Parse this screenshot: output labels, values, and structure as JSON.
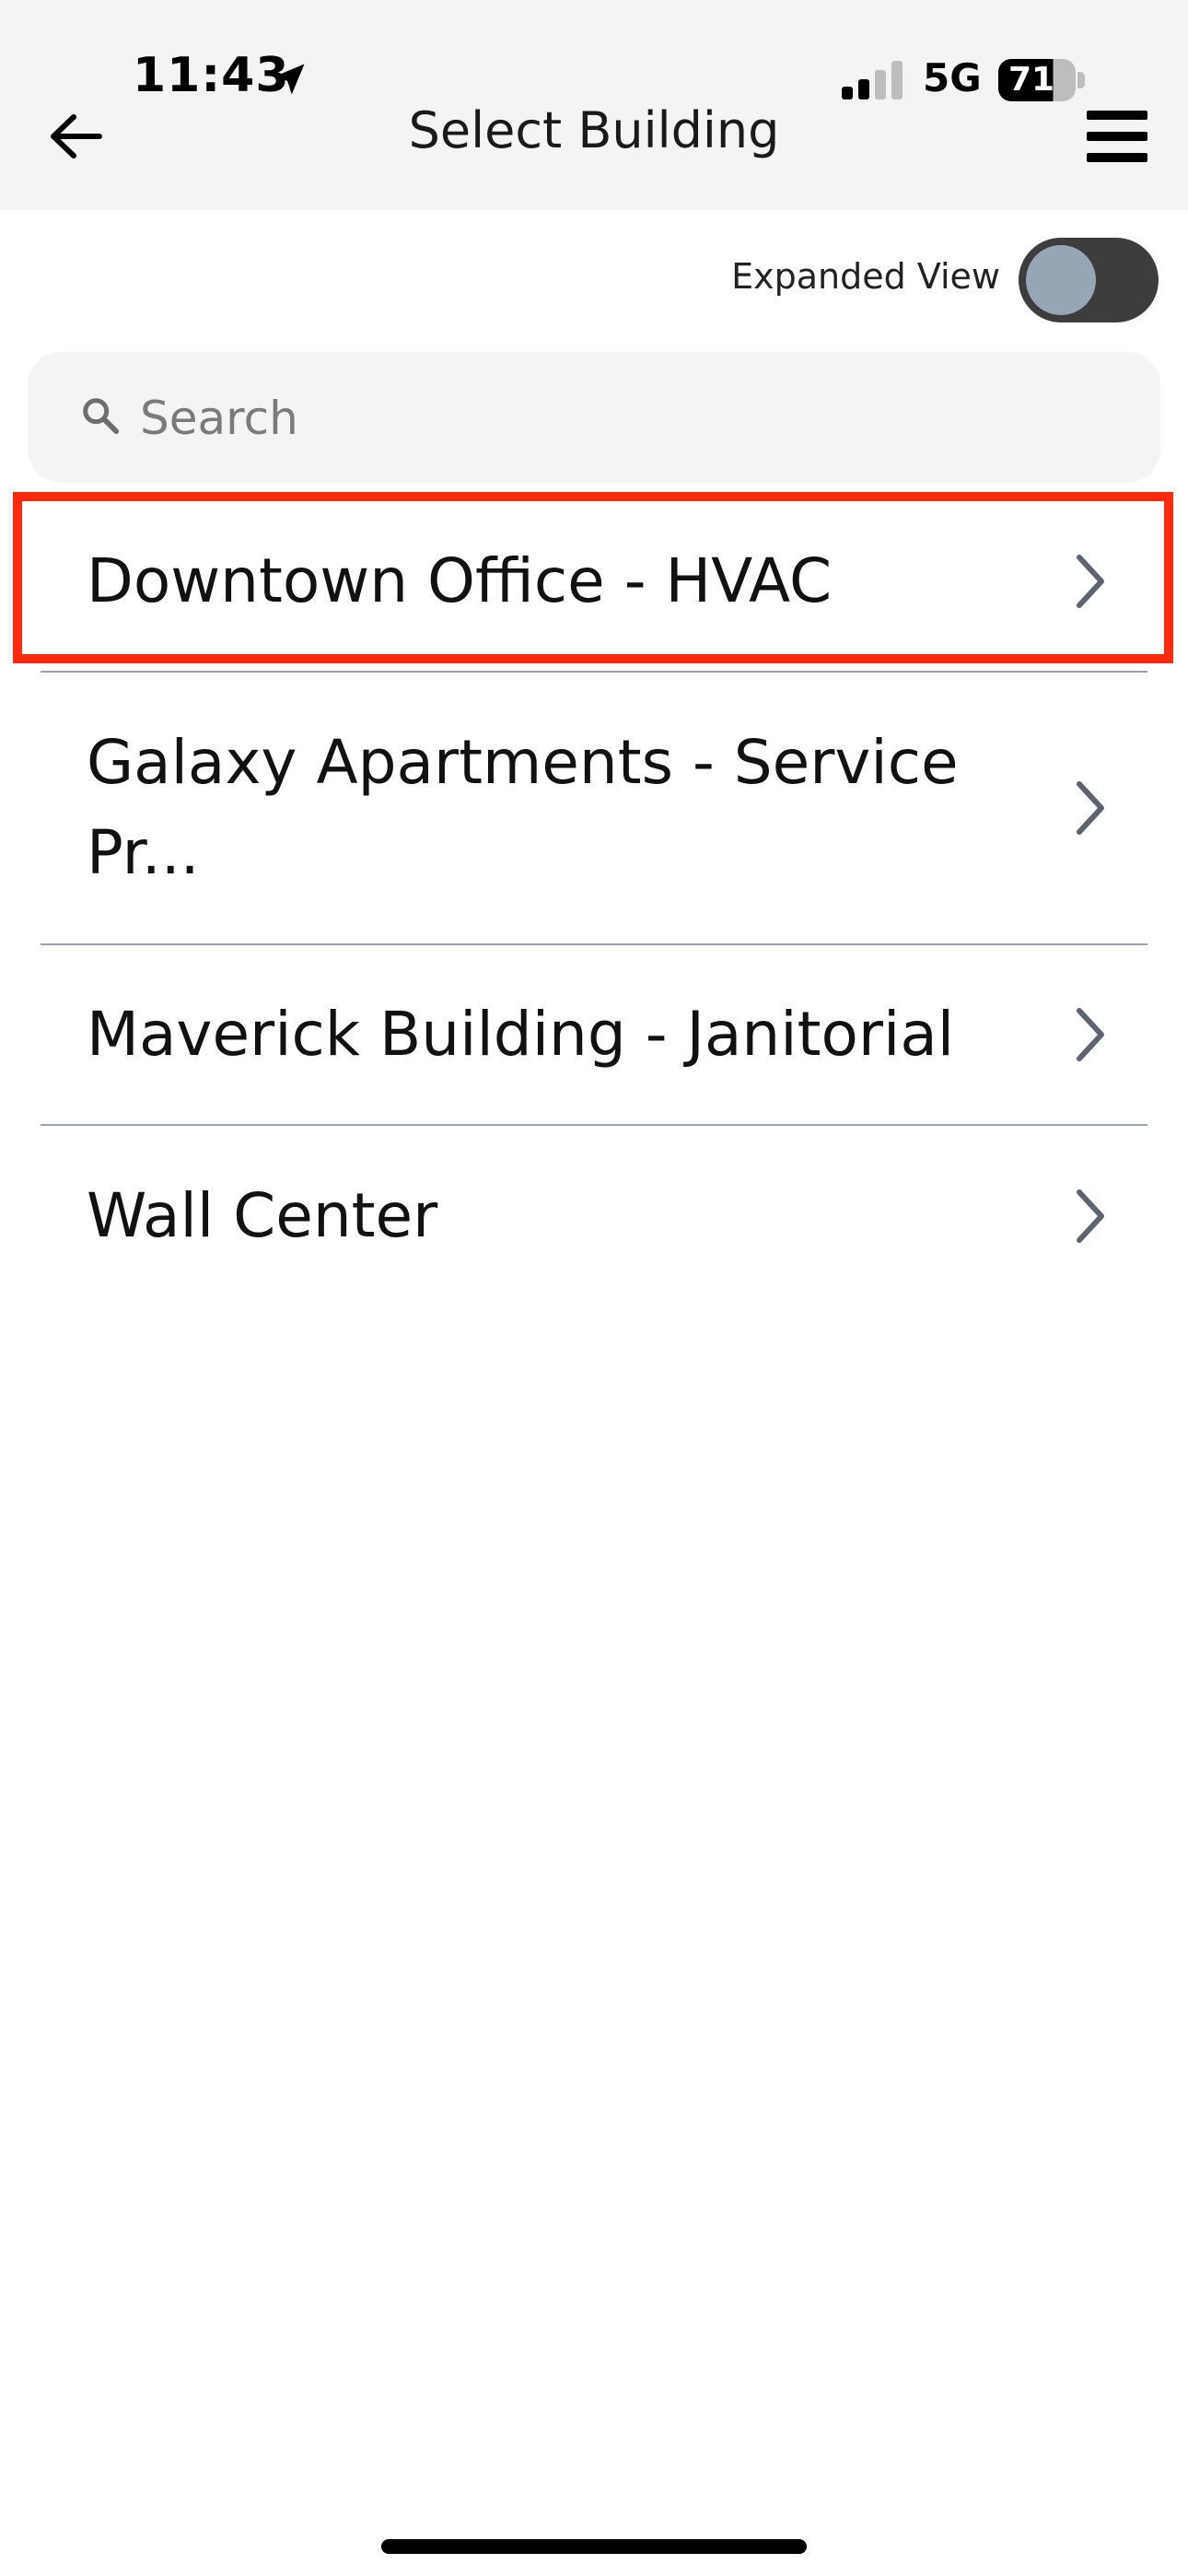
{
  "status_bar": {
    "time": "11:43",
    "network": "5G",
    "battery": "71"
  },
  "header": {
    "title": "Select Building"
  },
  "expanded_view": {
    "label": "Expanded View",
    "enabled": false
  },
  "search": {
    "placeholder": "Search",
    "value": ""
  },
  "buildings": [
    {
      "label": "Downtown Office - HVAC"
    },
    {
      "label": "Galaxy Apartments - Service Pr..."
    },
    {
      "label": "Maverick Building - Janitorial"
    },
    {
      "label": "Wall Center"
    }
  ],
  "colors": {
    "highlight": "#ff2a0f",
    "toggle_track": "#3d3d3d",
    "toggle_knob": "#97a6b5",
    "divider": "#9aa5b0",
    "header_bg": "#f4f4f4"
  }
}
